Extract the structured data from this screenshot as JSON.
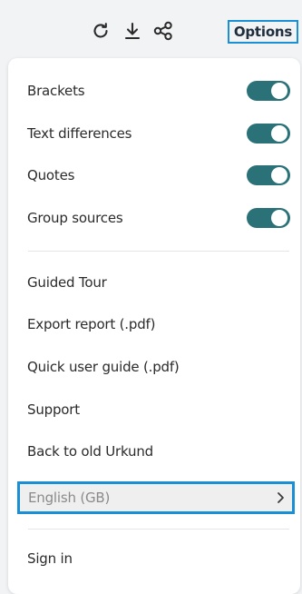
{
  "toolbar": {
    "icons": [
      "refresh-icon",
      "download-icon",
      "share-icon"
    ],
    "options_label": "Options",
    "accent_color": "#1a8fd6"
  },
  "options_menu": {
    "toggles": [
      {
        "label": "Brackets",
        "on": true
      },
      {
        "label": "Text differences",
        "on": true
      },
      {
        "label": "Quotes",
        "on": true
      },
      {
        "label": "Group sources",
        "on": true
      }
    ],
    "toggle_color": "#2a7178",
    "items": [
      {
        "label": "Guided Tour"
      },
      {
        "label": "Export report (.pdf)"
      },
      {
        "label": "Quick user guide (.pdf)"
      },
      {
        "label": "Support"
      },
      {
        "label": "Back to old Urkund"
      }
    ],
    "language": {
      "label": "English (GB)",
      "icon": "chevron-right-icon"
    },
    "sign_in_label": "Sign in"
  }
}
